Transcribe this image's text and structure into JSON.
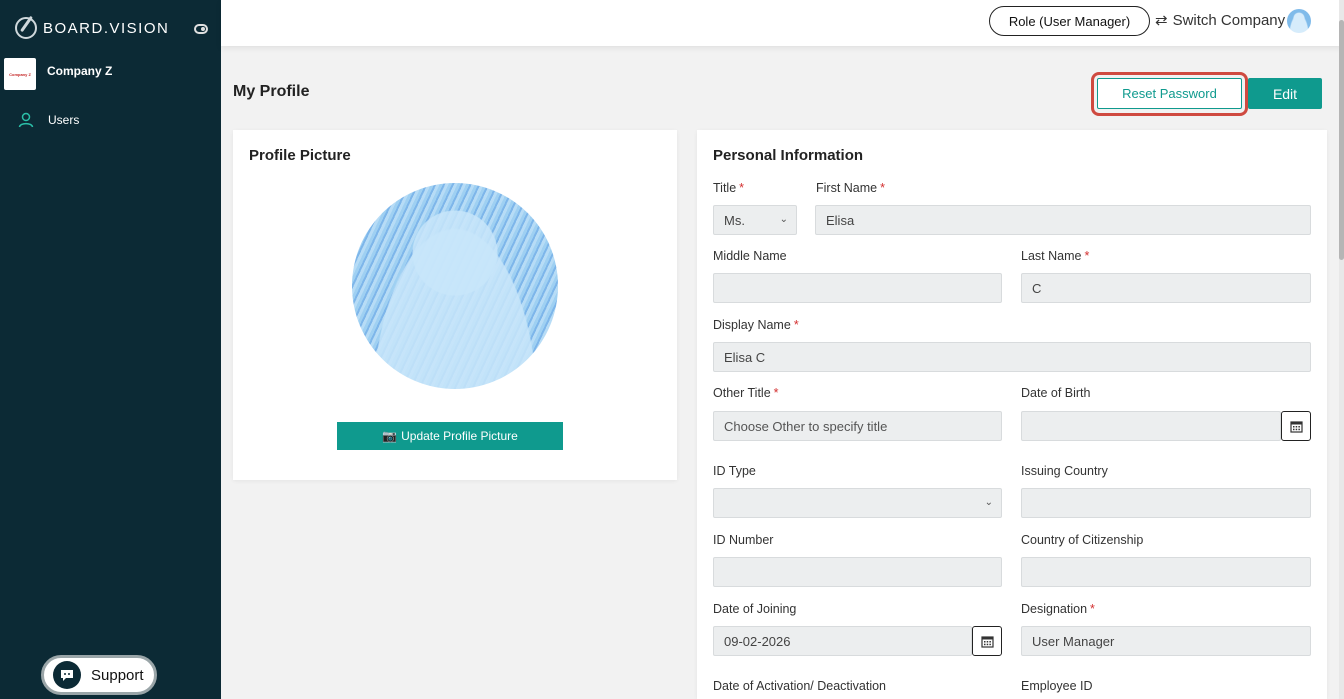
{
  "brand": {
    "name": "BOARD.VISION"
  },
  "sidebar": {
    "company": {
      "name": "Company Z",
      "logo_text": "Company Z"
    },
    "items": [
      {
        "label": "Users",
        "icon": "user-icon"
      }
    ],
    "support_label": "Support"
  },
  "topbar": {
    "role_label": "Role (User Manager)",
    "switch_company_label": "Switch Company"
  },
  "page": {
    "title": "My Profile",
    "reset_password_label": "Reset Password",
    "edit_label": "Edit"
  },
  "profile_picture": {
    "title": "Profile Picture",
    "update_label": "Update Profile Picture"
  },
  "personal_info": {
    "title": "Personal Information",
    "fields": {
      "title": {
        "label": "Title",
        "value": "Ms.",
        "required": true
      },
      "first_name": {
        "label": "First Name",
        "value": "Elisa",
        "required": true
      },
      "middle_name": {
        "label": "Middle Name",
        "value": ""
      },
      "last_name": {
        "label": "Last Name",
        "value": "C",
        "required": true
      },
      "display_name": {
        "label": "Display Name",
        "value": "Elisa C",
        "required": true
      },
      "other_title": {
        "label": "Other Title",
        "placeholder": "Choose Other to specify title",
        "required": true
      },
      "date_of_birth": {
        "label": "Date of Birth",
        "value": ""
      },
      "id_type": {
        "label": "ID Type",
        "value": ""
      },
      "issuing_country": {
        "label": "Issuing Country",
        "value": ""
      },
      "id_number": {
        "label": "ID Number",
        "value": ""
      },
      "country_of_citizenship": {
        "label": "Country of Citizenship",
        "value": ""
      },
      "date_of_joining": {
        "label": "Date of Joining",
        "value": "09-02-2026"
      },
      "designation": {
        "label": "Designation",
        "value": "User Manager",
        "required": true
      },
      "date_of_activation": {
        "label": "Date of Activation/ Deactivation"
      },
      "employee_id": {
        "label": "Employee ID"
      }
    }
  },
  "colors": {
    "sidebar_bg": "#0c2a35",
    "accent": "#0f9a8e",
    "highlight": "#cf4a40",
    "required": "#d32f2f"
  }
}
